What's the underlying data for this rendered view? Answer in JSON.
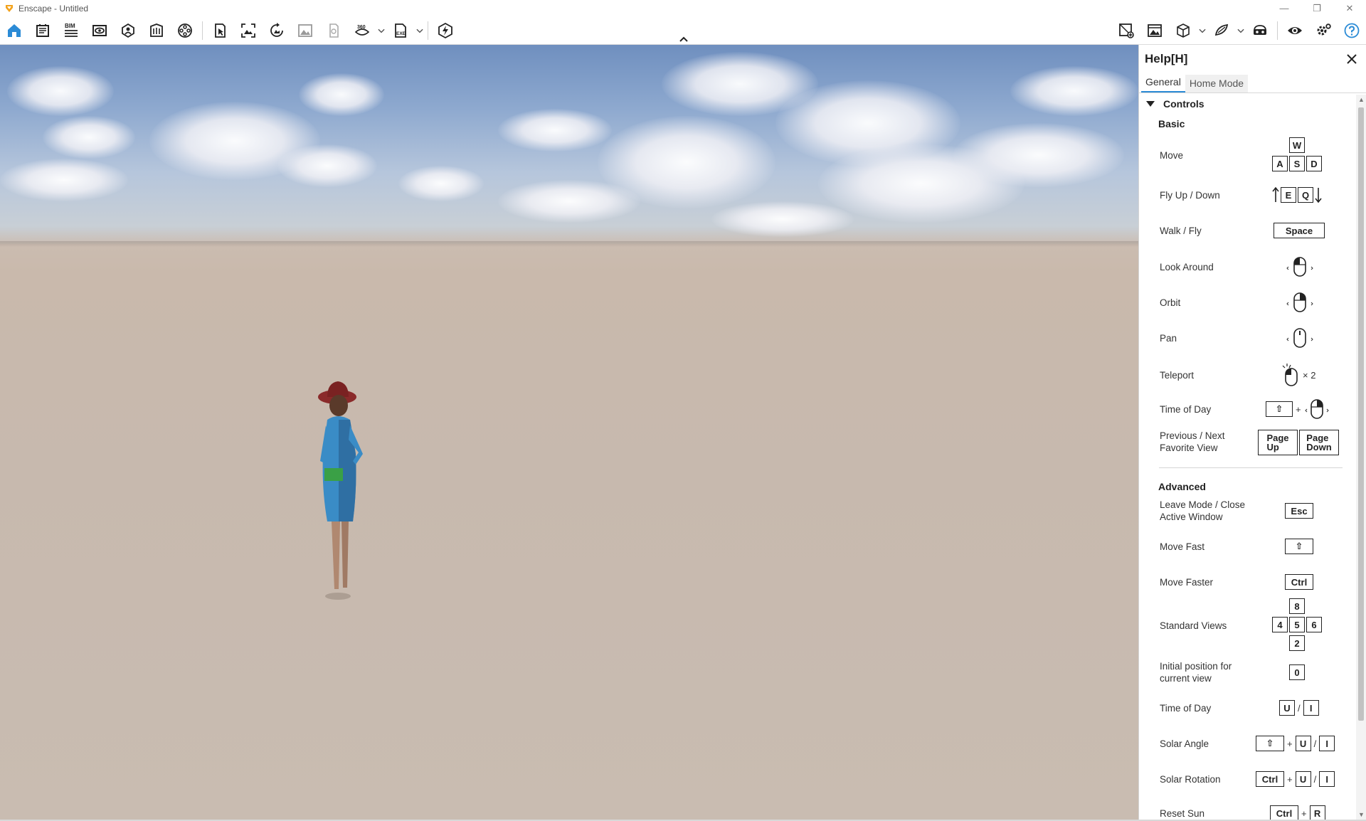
{
  "window": {
    "title": "Enscape - Untitled",
    "controls": {
      "minimize": "—",
      "restore": "❐",
      "close": "✕"
    }
  },
  "toolbar": {
    "left_icons": [
      "home-icon",
      "document-icon",
      "bim-icon",
      "eye-view-icon",
      "asset-library-icon",
      "building-icon",
      "film-reel-icon"
    ],
    "bim_label": "BIM",
    "middle_icons": [
      "cursor-icon",
      "screenshot-icon",
      "rotate-view-icon",
      "image-icon",
      "panorama-icon",
      "360-icon",
      "exe-export-icon"
    ],
    "label_360": "360",
    "label_exe": "EXE",
    "right_icons": [
      "visual-settings-icon",
      "render-view-icon",
      "cube-icon",
      "material-icon",
      "vr-headset-icon",
      "visibility-icon",
      "settings-icon",
      "help-icon"
    ],
    "accent": "#2b8bd6"
  },
  "help": {
    "title": "Help[H]",
    "tabs": [
      "General",
      "Home Mode"
    ],
    "section": "Controls",
    "basic_label": "Basic",
    "advanced_label": "Advanced",
    "basic": [
      {
        "label": "Move",
        "keys": [
          "W",
          "A",
          "S",
          "D"
        ]
      },
      {
        "label": "Fly Up / Down",
        "keys": [
          "E",
          "Q"
        ]
      },
      {
        "label": "Walk / Fly",
        "keys": [
          "Space"
        ]
      },
      {
        "label": "Look Around",
        "icon": "left-mouse-drag-icon"
      },
      {
        "label": "Orbit",
        "icon": "right-mouse-drag-icon"
      },
      {
        "label": "Pan",
        "icon": "middle-mouse-drag-icon"
      },
      {
        "label": "Teleport",
        "icon": "double-click-icon",
        "suffix": "× 2"
      },
      {
        "label": "Time of Day",
        "keys": [
          "⇧"
        ],
        "plus": "+",
        "icon": "right-mouse-drag-icon"
      },
      {
        "label": "Previous / Next Favorite View",
        "keys": [
          "Page Up",
          "Page Down"
        ]
      }
    ],
    "advanced": [
      {
        "label": "Leave Mode / Close Active Window",
        "keys": [
          "Esc"
        ]
      },
      {
        "label": "Move Fast",
        "keys": [
          "⇧"
        ]
      },
      {
        "label": "Move Faster",
        "keys": [
          "Ctrl"
        ]
      },
      {
        "label": "Standard Views",
        "keys": [
          "8",
          "4",
          "5",
          "6",
          "2"
        ]
      },
      {
        "label": "Initial position for current view",
        "keys": [
          "0"
        ]
      },
      {
        "label": "Time of Day",
        "keys": [
          "U",
          "I"
        ],
        "sep": "/"
      },
      {
        "label": "Solar Angle",
        "keys": [
          "⇧",
          "U",
          "I"
        ],
        "plus": "+",
        "sep": "/"
      },
      {
        "label": "Solar Rotation",
        "keys": [
          "Ctrl",
          "U",
          "I"
        ],
        "plus": "+",
        "sep": "/"
      },
      {
        "label": "Reset Sun",
        "keys": [
          "Ctrl",
          "R"
        ],
        "plus": "+"
      }
    ]
  }
}
